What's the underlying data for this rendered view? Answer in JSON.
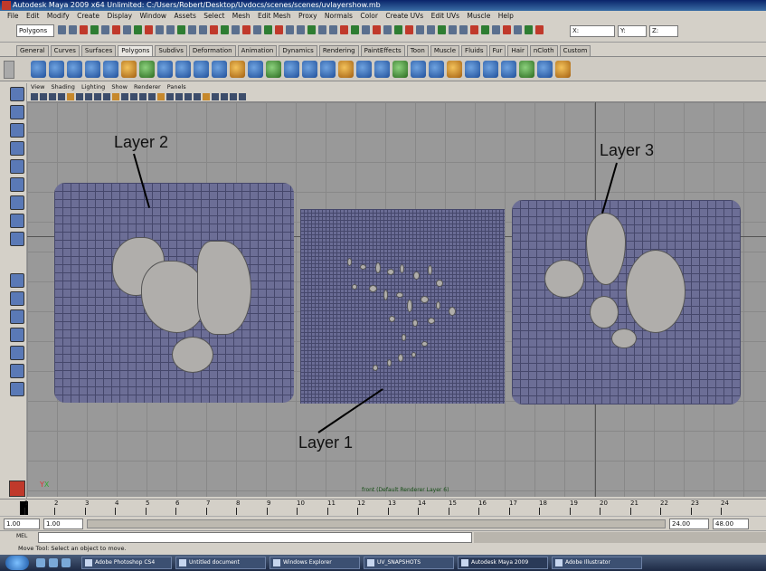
{
  "window": {
    "title": "Autodesk Maya 2009 x64 Unlimited: C:/Users/Robert/Desktop/Uvdocs/scenes/scenes/uvlayershow.mb"
  },
  "menubar": {
    "items": [
      "File",
      "Edit",
      "Modify",
      "Create",
      "Display",
      "Window",
      "Assets",
      "Select",
      "Mesh",
      "Edit Mesh",
      "Proxy",
      "Normals",
      "Color",
      "Create UVs",
      "Edit UVs",
      "Muscle",
      "Help"
    ]
  },
  "status_line": {
    "mode": "Polygons",
    "x_label": "X:",
    "y_label": "Y:",
    "z_label": "Z:"
  },
  "shelf": {
    "tabs": [
      "General",
      "Curves",
      "Surfaces",
      "Polygons",
      "Subdivs",
      "Deformation",
      "Animation",
      "Dynamics",
      "Rendering",
      "PaintEffects",
      "Toon",
      "Muscle",
      "Fluids",
      "Fur",
      "Hair",
      "nCloth",
      "Custom"
    ],
    "active_tab": "Polygons"
  },
  "panel": {
    "menu": [
      "View",
      "Shading",
      "Lighting",
      "Show",
      "Renderer",
      "Panels"
    ],
    "camera_name": "front (Default Renderer Layer 6)"
  },
  "annotations": {
    "layer1": "Layer 1",
    "layer2": "Layer 2",
    "layer3": "Layer 3"
  },
  "time_slider": {
    "current_frame": "1",
    "ticks": [
      "2",
      "3",
      "4",
      "5",
      "6",
      "7",
      "8",
      "9",
      "10",
      "11",
      "12",
      "13",
      "14",
      "15",
      "16",
      "17",
      "18",
      "19",
      "20",
      "21",
      "22",
      "23",
      "24"
    ]
  },
  "range_slider": {
    "start": "1.00",
    "playback_start": "1.00",
    "playback_end": "24.00",
    "end": "48.00"
  },
  "command_line": {
    "label": "MEL"
  },
  "help_line": {
    "text": "Move Tool: Select an object to move."
  },
  "taskbar": {
    "tasks": [
      "Adobe Photoshop CS4",
      "Untitled document",
      "Windows Explorer",
      "UV_SNAPSHOTS",
      "Autodesk Maya 2009",
      "Adobe Illustrator"
    ]
  }
}
